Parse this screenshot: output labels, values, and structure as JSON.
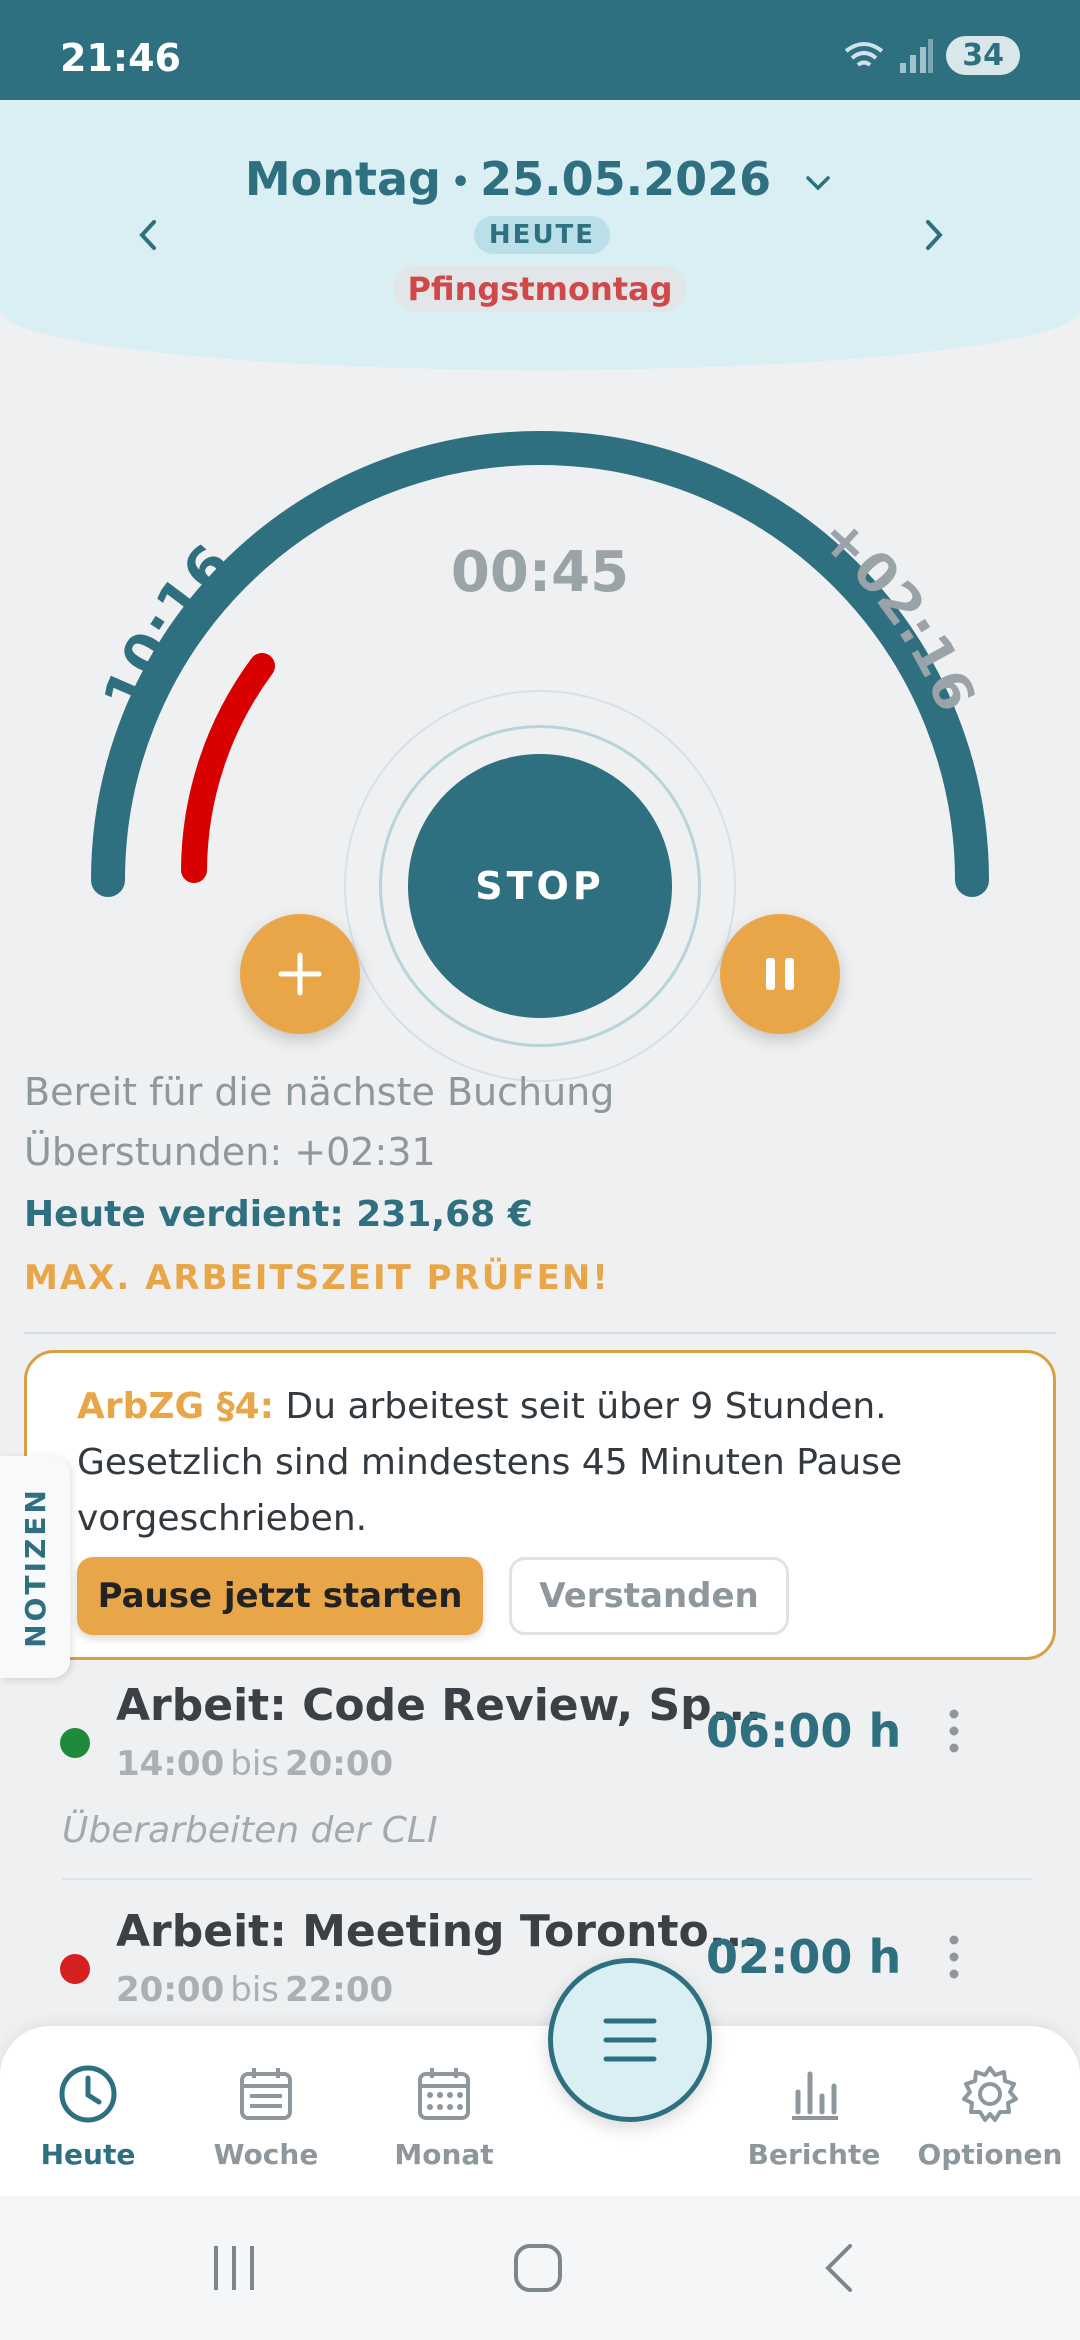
{
  "status_bar": {
    "time": "21:46",
    "battery": "34"
  },
  "date_header": {
    "weekday": "Montag",
    "date": "25.05.2026",
    "today_label": "HEUTE",
    "holiday": "Pfingstmontag"
  },
  "gauge": {
    "start_time": "10:16",
    "remaining": "+02:16",
    "elapsed": "00:45",
    "stop_label": "STOP"
  },
  "info": {
    "ready": "Bereit für die nächste Buchung",
    "overtime": "Überstunden: +02:31",
    "earned": "Heute verdient: 231,68 €",
    "warning": "MAX. ARBEITSZEIT PRÜFEN!"
  },
  "warning_card": {
    "title": "ArbZG §4:",
    "message": "Du arbeitest seit über 9 Stunden. Gesetzlich sind mindestens 45 Minuten Pause vorgeschrieben.",
    "primary_button": "Pause jetzt starten",
    "secondary_button": "Verstanden"
  },
  "notes_tab": {
    "label": "NOTIZEN"
  },
  "entries": [
    {
      "title": "Arbeit: Code Review, Sp...",
      "start": "14:00",
      "separator": "bis",
      "end": "20:00",
      "duration": "06:00 h",
      "note": "Überarbeiten der CLI",
      "status_color": "#1f8a3a"
    },
    {
      "title": "Arbeit: Meeting Toronto...",
      "start": "20:00",
      "separator": "bis",
      "end": "22:00",
      "duration": "02:00 h",
      "status_color": "#d61f1f"
    }
  ],
  "bottom_nav": {
    "items": [
      {
        "label": "Heute",
        "icon": "clock-icon",
        "active": true
      },
      {
        "label": "Woche",
        "icon": "calendar-week-icon"
      },
      {
        "label": "Monat",
        "icon": "calendar-month-icon"
      },
      {
        "label": "Berichte",
        "icon": "bar-chart-icon"
      },
      {
        "label": "Optionen",
        "icon": "gear-icon"
      }
    ]
  },
  "colors": {
    "primary": "#2e6f80",
    "accent": "#e8a648",
    "progress": "#d90000",
    "header_bg": "#d9eff4"
  }
}
